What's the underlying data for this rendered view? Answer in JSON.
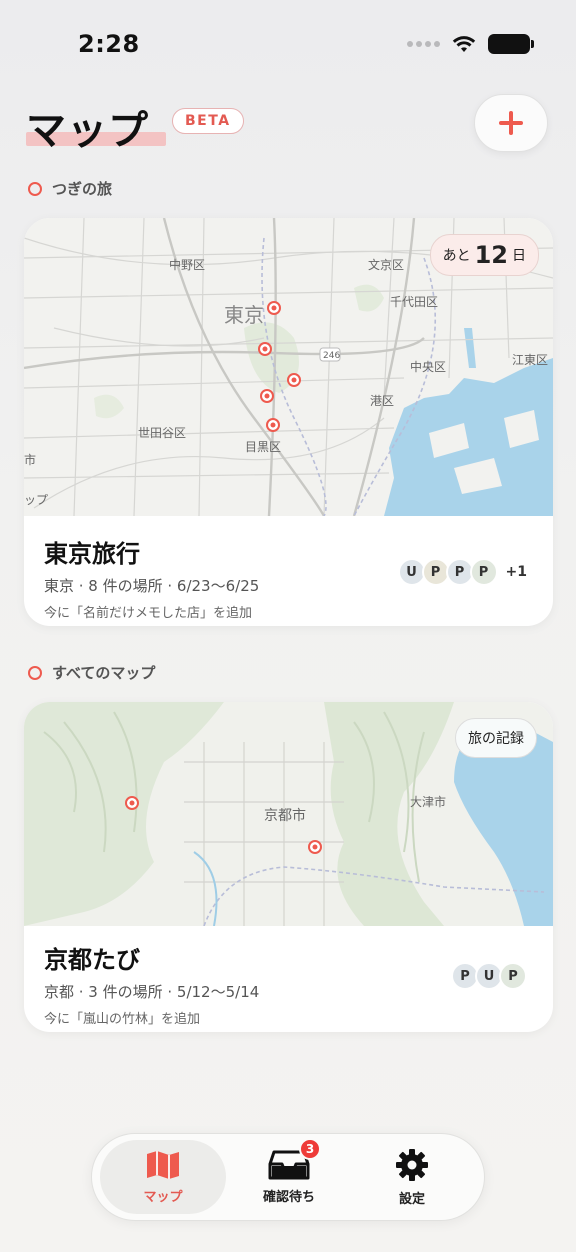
{
  "status_bar": {
    "time": "2:28"
  },
  "header": {
    "title": "マップ",
    "beta_label": "BETA",
    "add_icon": "plus-icon"
  },
  "next_trip_section": {
    "label": "つぎの旅"
  },
  "all_maps_section": {
    "label": "すべてのマップ"
  },
  "trips": [
    {
      "title": "東京旅行",
      "meta": "東京 · 8 件の場所 · 6/23〜6/25",
      "activity": "今に「名前だけメモした店」を追加",
      "countdown_prefix": "あと",
      "countdown_number": "12",
      "countdown_suffix": "日",
      "members": [
        "U",
        "P",
        "P",
        "P"
      ],
      "members_more": "+1",
      "map_labels": {
        "nakano": "中野区",
        "bunkyo": "文京区",
        "chiyoda": "千代田区",
        "tokyo": "東京",
        "chuo": "中央区",
        "koto": "江東区",
        "minato": "港区",
        "setagaya": "世田谷区",
        "meguro": "目黒区",
        "route246": "246",
        "city_partial": "市",
        "map_partial": "ップ"
      }
    },
    {
      "title": "京都たび",
      "meta": "京都 · 3 件の場所 · 5/12〜5/14",
      "activity": "今に「嵐山の竹林」を追加",
      "record_label": "旅の記録",
      "members": [
        "P",
        "U",
        "P"
      ],
      "map_labels": {
        "kyoto": "京都市",
        "otsu": "大津市"
      }
    }
  ],
  "tab_bar": {
    "map_label": "マップ",
    "inbox_label": "確認待ち",
    "inbox_badge": "3",
    "settings_label": "設定"
  },
  "colors": {
    "accent": "#ee5a4e",
    "title_highlight": "#f3c3c3",
    "badge": "#ee3b38",
    "water": "#a9d3ea"
  }
}
